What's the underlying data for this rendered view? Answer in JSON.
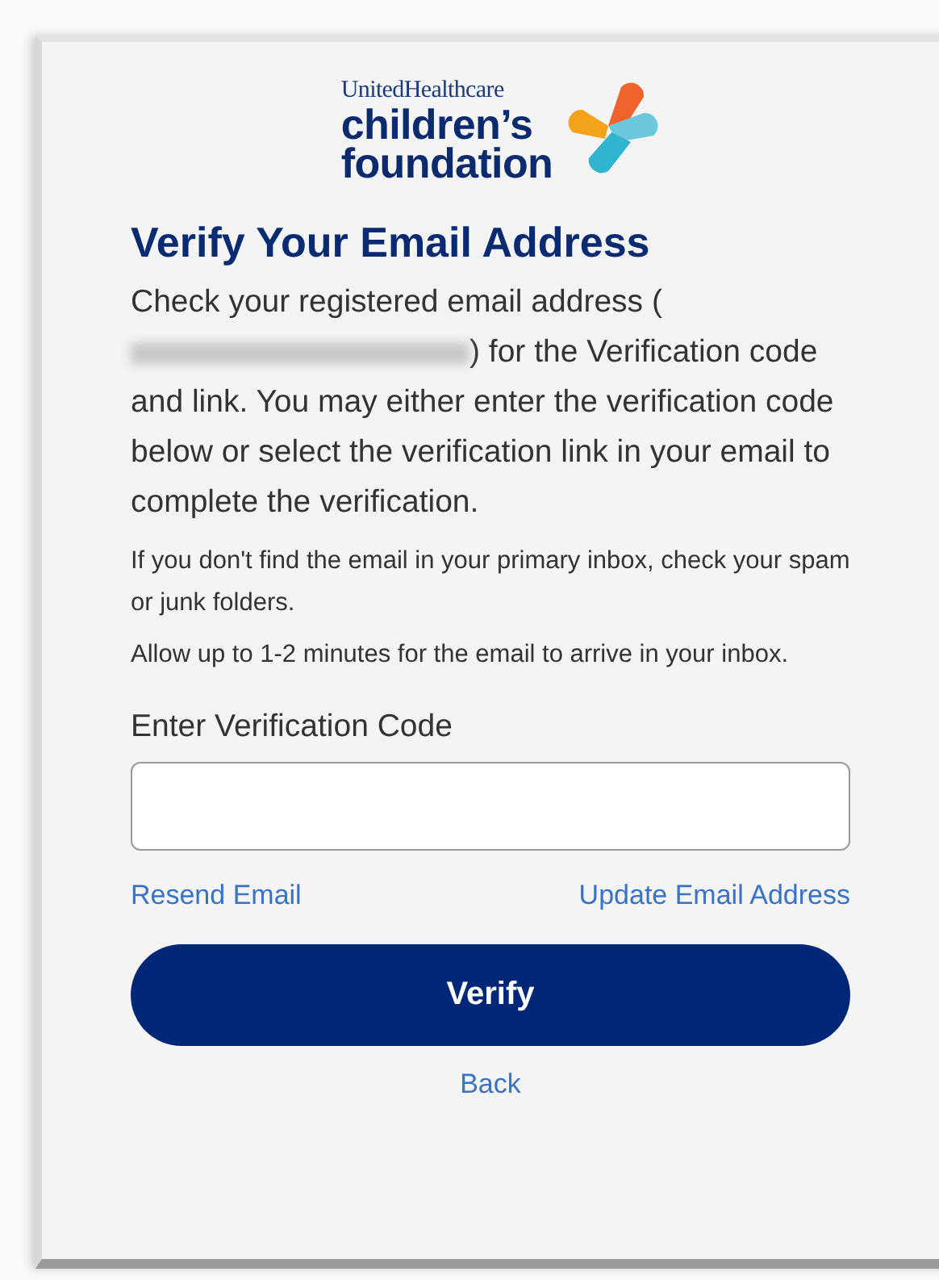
{
  "logo": {
    "brand": "UnitedHealthcare",
    "line_1": "children’s",
    "line_2": "foundation"
  },
  "title": "Verify Your Email Address",
  "intro_before": "Check your registered email address (",
  "intro_after": ") for the Verification code and link. You may either enter the verification code below or select the verification link in your email to complete the verification.",
  "notes": [
    "If you don't find the email in your primary inbox, check your spam or junk folders.",
    "Allow up to 1-2 minutes for the email to arrive in your inbox."
  ],
  "code_field": {
    "label": "Enter Verification Code"
  },
  "links": [
    "Resend Email",
    "Update Email Address"
  ],
  "verify_button": "Verify",
  "back_link": "Back"
}
